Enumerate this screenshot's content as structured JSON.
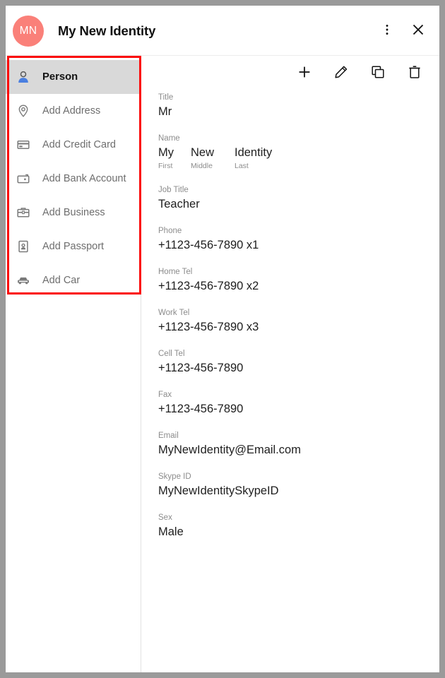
{
  "header": {
    "avatar_initials": "MN",
    "title": "My New Identity",
    "menu_icon": "more-vertical-icon",
    "close_icon": "close-icon"
  },
  "sidebar": {
    "items": [
      {
        "label": "Person",
        "icon": "person-icon",
        "selected": true
      },
      {
        "label": "Add Address",
        "icon": "location-pin-icon",
        "selected": false
      },
      {
        "label": "Add Credit Card",
        "icon": "credit-card-icon",
        "selected": false
      },
      {
        "label": "Add Bank Account",
        "icon": "wallet-icon",
        "selected": false
      },
      {
        "label": "Add Business",
        "icon": "briefcase-icon",
        "selected": false
      },
      {
        "label": "Add Passport",
        "icon": "passport-icon",
        "selected": false
      },
      {
        "label": "Add Car",
        "icon": "car-icon",
        "selected": false
      }
    ]
  },
  "toolbar": {
    "add_label": "add-icon",
    "edit_label": "pencil-icon",
    "copy_label": "copy-icon",
    "delete_label": "trash-icon"
  },
  "details": {
    "title": {
      "label": "Title",
      "value": "Mr"
    },
    "name": {
      "label": "Name",
      "first": {
        "value": "My",
        "sublabel": "First"
      },
      "middle": {
        "value": "New",
        "sublabel": "Middle"
      },
      "last": {
        "value": "Identity",
        "sublabel": "Last"
      }
    },
    "job_title": {
      "label": "Job Title",
      "value": "Teacher"
    },
    "phone": {
      "label": "Phone",
      "value": "+1123-456-7890 x1"
    },
    "home_tel": {
      "label": "Home Tel",
      "value": "+1123-456-7890 x2"
    },
    "work_tel": {
      "label": "Work Tel",
      "value": "+1123-456-7890 x3"
    },
    "cell_tel": {
      "label": "Cell Tel",
      "value": "+1123-456-7890"
    },
    "fax": {
      "label": "Fax",
      "value": "+1123-456-7890"
    },
    "email": {
      "label": "Email",
      "value": "MyNewIdentity@Email.com"
    },
    "skype_id": {
      "label": "Skype ID",
      "value": "MyNewIdentitySkypeID"
    },
    "sex": {
      "label": "Sex",
      "value": "Male"
    }
  },
  "colors": {
    "avatar_bg": "#fa8079",
    "selected_row_bg": "#d9d9d9",
    "annotation_border": "#fb0a0a",
    "person_icon_blue": "#4a7fe0",
    "label_gray": "#8c8c8c",
    "value_dark": "#1e1e1e"
  }
}
